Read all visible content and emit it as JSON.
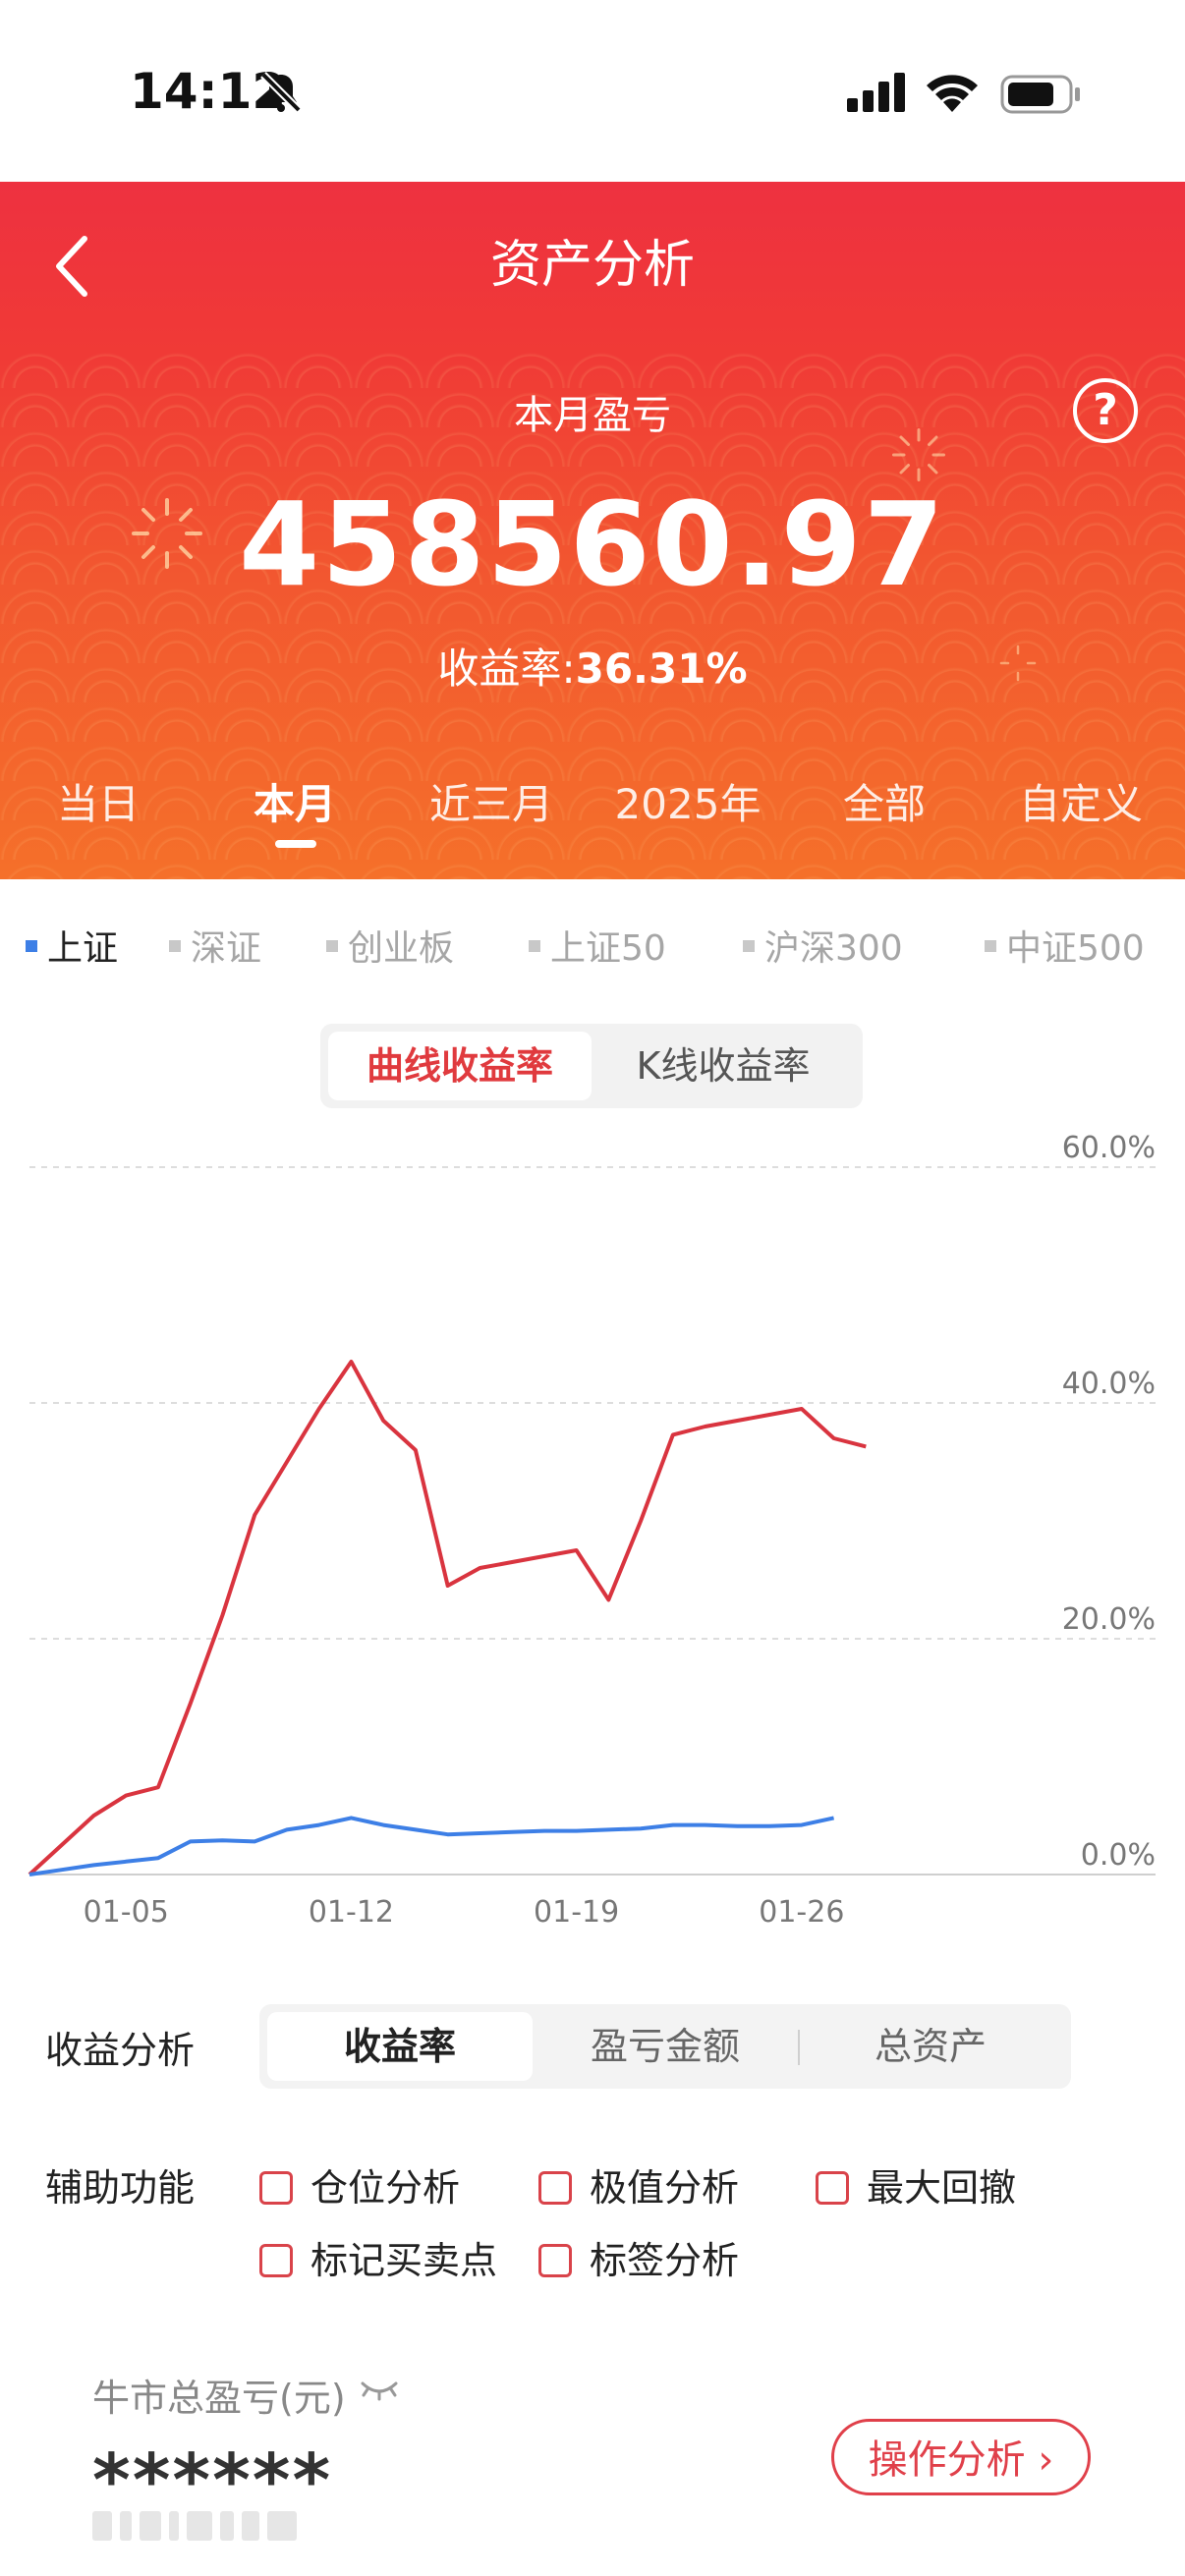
{
  "status": {
    "time": "14:12"
  },
  "header": {
    "title": "资产分析",
    "pnl_label": "本月盈亏",
    "pnl_value": "458560.97",
    "rate_label": "收益率:",
    "rate_value": "36.31%",
    "help": "?"
  },
  "periods": [
    {
      "label": "当日"
    },
    {
      "label": "本月",
      "active": true
    },
    {
      "label": "近三月"
    },
    {
      "label": "2025年"
    },
    {
      "label": "全部"
    },
    {
      "label": "自定义"
    }
  ],
  "indices": [
    {
      "label": "上证",
      "active": true
    },
    {
      "label": "深证"
    },
    {
      "label": "创业板"
    },
    {
      "label": "上证50"
    },
    {
      "label": "沪深300"
    },
    {
      "label": "中证500"
    }
  ],
  "chart_toggle": {
    "curve": "曲线收益率",
    "kline": "K线收益率"
  },
  "colors": {
    "accent_red": "#e03a3e",
    "portfolio_line": "#d9343f",
    "index_line": "#3d7fe6"
  },
  "chart_data": {
    "type": "line",
    "x_ticks": [
      "01-05",
      "01-12",
      "01-19",
      "01-26"
    ],
    "y_ticks": [
      "60.0%",
      "40.0%",
      "20.0%",
      "0.0%"
    ],
    "ylim": [
      0,
      60
    ],
    "grid": true,
    "days": [
      2,
      3,
      4,
      5,
      6,
      7,
      8,
      9,
      10,
      11,
      12,
      13,
      14,
      15,
      16,
      17,
      18,
      19,
      20,
      21,
      22,
      23,
      24,
      25,
      26,
      27,
      28
    ],
    "series": [
      {
        "color": "#d9343f",
        "values": [
          0,
          2.5,
          5,
          6.7,
          7.4,
          14.5,
          22,
          30.5,
          35,
          39.5,
          43.5,
          38.5,
          36,
          24.5,
          26,
          26.5,
          27,
          27.5,
          23.3,
          30,
          37.3,
          38,
          38.5,
          39,
          39.5,
          37,
          36.3
        ]
      },
      {
        "color": "#3d7fe6",
        "values": [
          0,
          0.4,
          0.8,
          1.1,
          1.4,
          2.8,
          2.9,
          2.8,
          3.8,
          4.2,
          4.8,
          4.2,
          3.8,
          3.4,
          3.5,
          3.6,
          3.7,
          3.7,
          3.8,
          3.9,
          4.2,
          4.2,
          4.1,
          4.1,
          4.2,
          4.8
        ]
      }
    ]
  },
  "analysis": {
    "label": "收益分析",
    "options": [
      {
        "label": "收益率",
        "active": true
      },
      {
        "label": "盈亏金额"
      },
      {
        "label": "总资产"
      }
    ]
  },
  "aux": {
    "label": "辅助功能",
    "items": [
      "仓位分析",
      "极值分析",
      "最大回撤",
      "标记买卖点",
      "标签分析"
    ]
  },
  "bottom": {
    "bull_label": "牛市总盈亏(元)",
    "masked_value": "******",
    "op_button": "操作分析 ›"
  }
}
